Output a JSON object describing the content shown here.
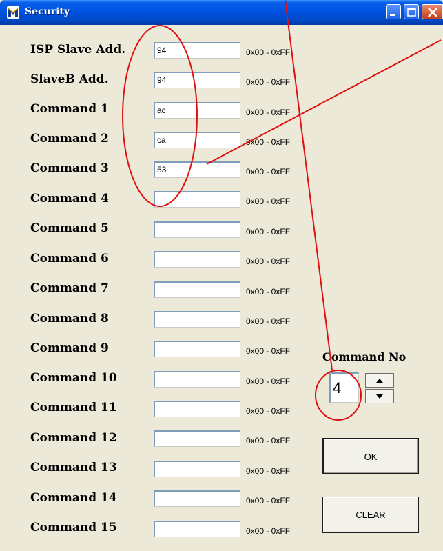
{
  "window": {
    "title": "Security",
    "controls": [
      "minimize-icon",
      "maximize-icon",
      "close-icon"
    ]
  },
  "fields": [
    {
      "label": "ISP Slave Add.",
      "value": "94",
      "range": "0x00 - 0xFF"
    },
    {
      "label": "SlaveB Add.",
      "value": "94",
      "range": "0x00 - 0xFF"
    },
    {
      "label": "Command 1",
      "value": "ac",
      "range": "0x00 - 0xFF"
    },
    {
      "label": "Command 2",
      "value": "ca",
      "range": "0x00 - 0xFF"
    },
    {
      "label": "Command 3",
      "value": "53",
      "range": "0x00 - 0xFF"
    },
    {
      "label": "Command 4",
      "value": "",
      "range": "0x00 - 0xFF"
    },
    {
      "label": "Command 5",
      "value": "",
      "range": "0x00 - 0xFF"
    },
    {
      "label": "Command 6",
      "value": "",
      "range": "0x00 - 0xFF"
    },
    {
      "label": "Command 7",
      "value": "",
      "range": "0x00 - 0xFF"
    },
    {
      "label": "Command 8",
      "value": "",
      "range": "0x00 - 0xFF"
    },
    {
      "label": "Command 9",
      "value": "",
      "range": "0x00 - 0xFF"
    },
    {
      "label": "Command 10",
      "value": "",
      "range": "0x00 - 0xFF"
    },
    {
      "label": "Command 11",
      "value": "",
      "range": "0x00 - 0xFF"
    },
    {
      "label": "Command 12",
      "value": "",
      "range": "0x00 - 0xFF"
    },
    {
      "label": "Command 13",
      "value": "",
      "range": "0x00 - 0xFF"
    },
    {
      "label": "Command 14",
      "value": "",
      "range": "0x00 - 0xFF"
    },
    {
      "label": "Command 15",
      "value": "",
      "range": "0x00 - 0xFF"
    }
  ],
  "command_no": {
    "label": "Command No",
    "value": "4",
    "up_icon": "triangle-up-icon",
    "down_icon": "triangle-down-icon"
  },
  "buttons": {
    "ok": "OK",
    "clear": "CLEAR"
  },
  "annotation": {
    "color": "#e01010"
  }
}
